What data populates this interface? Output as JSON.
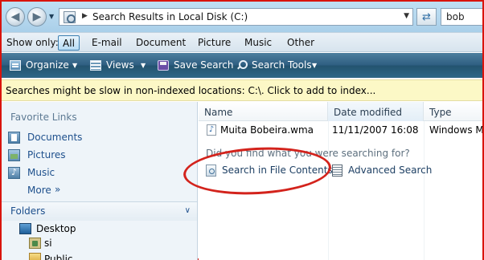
{
  "address_bar": {
    "back_icon": "back-arrow-icon",
    "forward_icon": "forward-arrow-icon",
    "path_separator": "▶",
    "path": "Search Results in Local Disk (C:)",
    "search_value": "bob"
  },
  "show_only": {
    "label": "Show only:",
    "filters": [
      "All",
      "E-mail",
      "Document",
      "Picture",
      "Music",
      "Other"
    ],
    "selected": "All"
  },
  "command_bar": {
    "organize": "Organize",
    "views": "Views",
    "save_search": "Save Search",
    "search_tools": "Search Tools",
    "dropdown_glyph": "▼"
  },
  "info_bar": {
    "message": "Searches might be slow in non-indexed locations: C:\\. Click to add to index..."
  },
  "nav_pane": {
    "favorite_links_heading": "Favorite Links",
    "favorites": [
      "Documents",
      "Pictures",
      "Music"
    ],
    "more": "More",
    "more_glyph": "»",
    "folders_heading": "Folders",
    "folders_glyph": "∨",
    "tree": [
      "Desktop",
      "si",
      "Public"
    ]
  },
  "file_list": {
    "columns": [
      "Name",
      "Date modified",
      "Type"
    ],
    "rows": [
      {
        "name": "Muita Bobeira.wma",
        "date_modified": "11/11/2007 16:08",
        "type": "Windows Me"
      }
    ],
    "prompt": "Did you find what you were searching for?",
    "link_search_contents": "Search in File Contents",
    "link_advanced_search": "Advanced Search"
  },
  "colors": {
    "frame_border": "#d9140d",
    "annotation": "#d3231c",
    "command_bar": "#2f5f82",
    "info_bar": "#fcf8c6",
    "link": "#1d4f8c"
  }
}
